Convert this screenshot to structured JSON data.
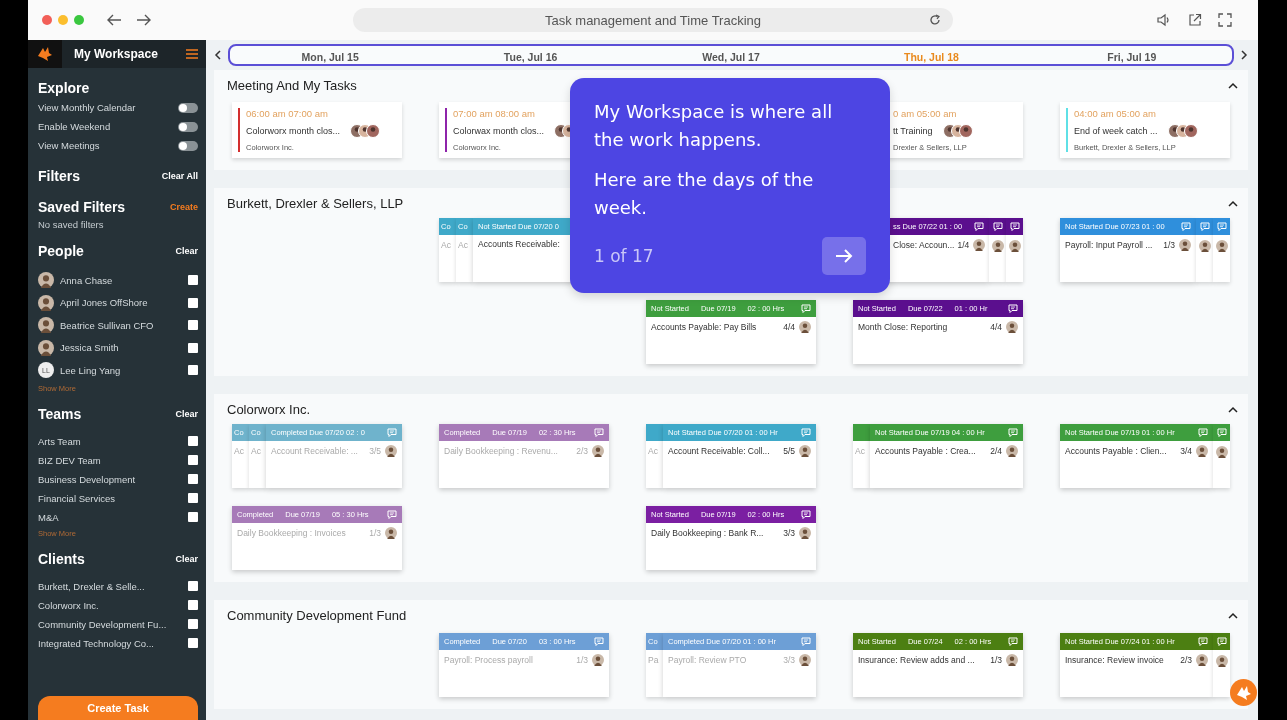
{
  "browser": {
    "address": "Task management and Time Tracking"
  },
  "sidebar": {
    "title": "My Workspace",
    "explore": {
      "title": "Explore",
      "toggles": [
        {
          "label": "View Monthly Calendar",
          "on": false
        },
        {
          "label": "Enable Weekend",
          "on": false
        },
        {
          "label": "View Meetings",
          "on": false
        }
      ]
    },
    "filters": {
      "title": "Filters",
      "action": "Clear All"
    },
    "saved_filters": {
      "title": "Saved Filters",
      "action": "Create",
      "empty": "No saved filters"
    },
    "people": {
      "title": "People",
      "action": "Clear",
      "more": "Show More",
      "items": [
        {
          "label": "Anna Chase",
          "checked": false
        },
        {
          "label": "April Jones OffShore",
          "checked": false
        },
        {
          "label": "Beatrice Sullivan CFO",
          "checked": false
        },
        {
          "label": "Jessica Smith",
          "checked": false
        },
        {
          "label": "Lee Ling Yang",
          "initials": "LL",
          "checked": false
        }
      ]
    },
    "teams": {
      "title": "Teams",
      "action": "Clear",
      "more": "Show More",
      "items": [
        {
          "label": "Arts Team",
          "checked": false
        },
        {
          "label": "BIZ DEV Team",
          "checked": false
        },
        {
          "label": "Business Development",
          "checked": false
        },
        {
          "label": "Financial Services",
          "checked": false
        },
        {
          "label": "M&A",
          "checked": false
        }
      ]
    },
    "clients": {
      "title": "Clients",
      "action": "Clear",
      "items": [
        {
          "label": "Burkett, Drexler & Selle...",
          "checked": false
        },
        {
          "label": "Colorworx Inc.",
          "checked": false
        },
        {
          "label": "Community Development Fu...",
          "checked": false
        },
        {
          "label": "Integrated Technology Co...",
          "checked": false
        }
      ]
    },
    "create_button": "Create Task"
  },
  "days": [
    {
      "label": "Mon, Jul 15",
      "selected": false
    },
    {
      "label": "Tue, Jul 16",
      "selected": false
    },
    {
      "label": "Wed, Jul 17",
      "selected": false
    },
    {
      "label": "Thu, Jul 18",
      "selected": true
    },
    {
      "label": "Fri, Jul 19",
      "selected": false
    }
  ],
  "sections": [
    {
      "title": "Meeting And My Tasks",
      "kind": "meetings",
      "rows": [
        [
          {
            "time": "06:00 am 07:00 am",
            "title": "Colorworx month clos...",
            "client": "Colorworx Inc.",
            "color": "#d32f2f"
          },
          {
            "time": "07:00 am 08:00 am",
            "title": "Colorwax month clos...",
            "client": "Colorworx Inc.",
            "color": "#8e24aa"
          },
          null,
          {
            "time": "0 am 05:00 am",
            "title": "tt Training",
            "client": "Drexler & Sellers, LLP",
            "covered": true
          },
          {
            "time": "04:00 am 05:00 am",
            "title": "End of week catch ...",
            "client": "Burkett, Drexler & Sellers, LLP",
            "color": "#5fe0e6"
          }
        ]
      ]
    },
    {
      "title": "Burkett, Drexler & Sellers, LLP",
      "kind": "tasks",
      "rows": [
        [
          null,
          {
            "header": [
              "Not Started Due 07/20 0"
            ],
            "title": "Accounts Receivable:",
            "color": "#3fa9c9",
            "completed": false,
            "behind": [
              {
                "kind": "left",
                "header": "Co",
                "title": "Ac"
              },
              {
                "kind": "left",
                "header": "Co",
                "title": "Ac"
              }
            ]
          },
          null,
          {
            "header": [
              "ss Due 07/22 01 : 00"
            ],
            "title": "Close: Accoun...",
            "count": "1/4",
            "color": "#5b0f8e",
            "completed": false,
            "covered": true,
            "behind": [
              {
                "kind": "right"
              },
              {
                "kind": "right"
              }
            ]
          },
          {
            "header": [
              "Not Started Due 07/23 01 : 00"
            ],
            "title": "Payroll: Input Payroll ...",
            "count": "1/3",
            "color": "#2f8fdc",
            "completed": false,
            "behind": [
              {
                "kind": "right"
              },
              {
                "kind": "right"
              }
            ]
          }
        ],
        [
          null,
          null,
          {
            "header": [
              "Not Started",
              "Due 07/19",
              "02 : 00 Hrs"
            ],
            "title": "Accounts Payable: Pay Bills",
            "count": "4/4",
            "color": "#3e9e3e",
            "completed": false
          },
          {
            "header": [
              "Not Started",
              "Due 07/22",
              "01 : 00 Hr"
            ],
            "title": "Month Close: Reporting",
            "count": "4/4",
            "color": "#5b0f8e",
            "completed": false
          },
          null
        ]
      ]
    },
    {
      "title": "Colorworx Inc.",
      "kind": "tasks",
      "rows": [
        [
          {
            "header": [
              "Completed Due 07/20 02 : 0"
            ],
            "title": "Account Receivable: ...",
            "count": "3/5",
            "color": "#6fb3cc",
            "completed": true,
            "behind": [
              {
                "kind": "left",
                "header": "Co",
                "title": "Ac"
              },
              {
                "kind": "left",
                "header": "Co",
                "title": "Ac"
              }
            ]
          },
          {
            "header": [
              "Completed",
              "Due 07/19",
              "02 : 30 Hrs"
            ],
            "title": "Daily Bookkeeping : Revenu...",
            "count": "2/3",
            "color": "#a77ab8",
            "completed": true
          },
          {
            "header": [
              "Not Started Due 07/20 01 : 00 Hr"
            ],
            "title": "Account Receivable: Coll...",
            "count": "5/5",
            "color": "#3fa9c9",
            "completed": false,
            "behind": [
              {
                "kind": "left",
                "title": "Ac"
              }
            ]
          },
          {
            "header": [
              "Not Started Due 07/19 04 : 00 Hr"
            ],
            "title": "Accounts Payable : Crea...",
            "count": "2/4",
            "color": "#3e9e3e",
            "completed": false,
            "behind": [
              {
                "kind": "left",
                "title": "Ac"
              }
            ]
          },
          {
            "header": [
              "Not Started Due 07/19 01 : 00 Hr"
            ],
            "title": "Accounts Payable : Clien...",
            "count": "3/4",
            "color": "#3e9e3e",
            "completed": false,
            "behind": [
              {
                "kind": "right"
              }
            ]
          }
        ],
        [
          {
            "header": [
              "Completed",
              "Due 07/19",
              "05 : 30 Hrs"
            ],
            "title": "Daily Bookkeeping : Invoices",
            "count": "1/3",
            "color": "#a77ab8",
            "completed": true
          },
          null,
          {
            "header": [
              "Not Started",
              "Due 07/19",
              "02 : 00 Hrs"
            ],
            "title": "Daily Bookkeeping : Bank R...",
            "count": "3/3",
            "color": "#7b1fa2",
            "completed": false
          },
          null,
          null
        ]
      ]
    },
    {
      "title": "Community Development Fund",
      "kind": "tasks",
      "rows": [
        [
          null,
          {
            "header": [
              "Completed",
              "Due 07/20",
              "03 : 00 Hrs"
            ],
            "title": "Payroll: Process payroll",
            "count": "1/3",
            "color": "#6d9fd6",
            "completed": true
          },
          {
            "header": [
              "Completed Due 07/20 01 : 00 Hr"
            ],
            "title": "Payroll: Review PTO",
            "count": "3/3",
            "color": "#6d9fd6",
            "completed": true,
            "behind": [
              {
                "kind": "left",
                "header": "Co",
                "title": "Pa"
              }
            ]
          },
          {
            "header": [
              "Not Started",
              "Due 07/24",
              "02 : 00 Hrs"
            ],
            "title": "Insurance: Review adds and ...",
            "count": "1/3",
            "color": "#4c7f12",
            "completed": false
          },
          {
            "header": [
              "Not Started Due 07/24 01 : 00 Hr"
            ],
            "title": "Insurance: Review invoice",
            "count": "2/3",
            "color": "#4c7f12",
            "completed": false,
            "behind": [
              {
                "kind": "right"
              }
            ]
          }
        ]
      ]
    }
  ],
  "tour": {
    "paragraphs": [
      "My Workspace is where all the work happens.",
      "Here are the days of the week."
    ],
    "counter": "1 of 17"
  }
}
